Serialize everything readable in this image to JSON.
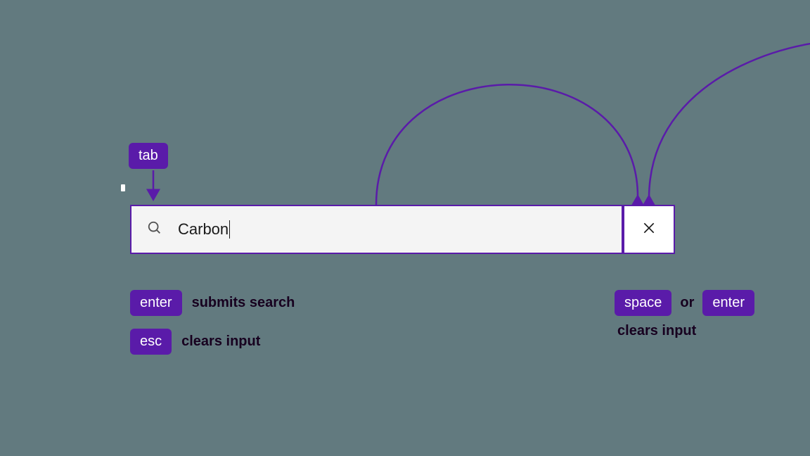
{
  "colors": {
    "accent": "#5a1ba9",
    "background": "#627a7f",
    "inputBg": "#f4f4f4",
    "clearBg": "#ffffff",
    "text": "#17001f"
  },
  "tab_key": {
    "label": "tab"
  },
  "search": {
    "value": "Carbon",
    "icon": "search-icon",
    "clear_icon": "close-icon"
  },
  "left_hints": [
    {
      "key": "enter",
      "text": "submits search"
    },
    {
      "key": "esc",
      "text": "clears input"
    }
  ],
  "right_hints": {
    "keys": [
      "space",
      "enter"
    ],
    "separator": "or",
    "text": "clears input"
  }
}
